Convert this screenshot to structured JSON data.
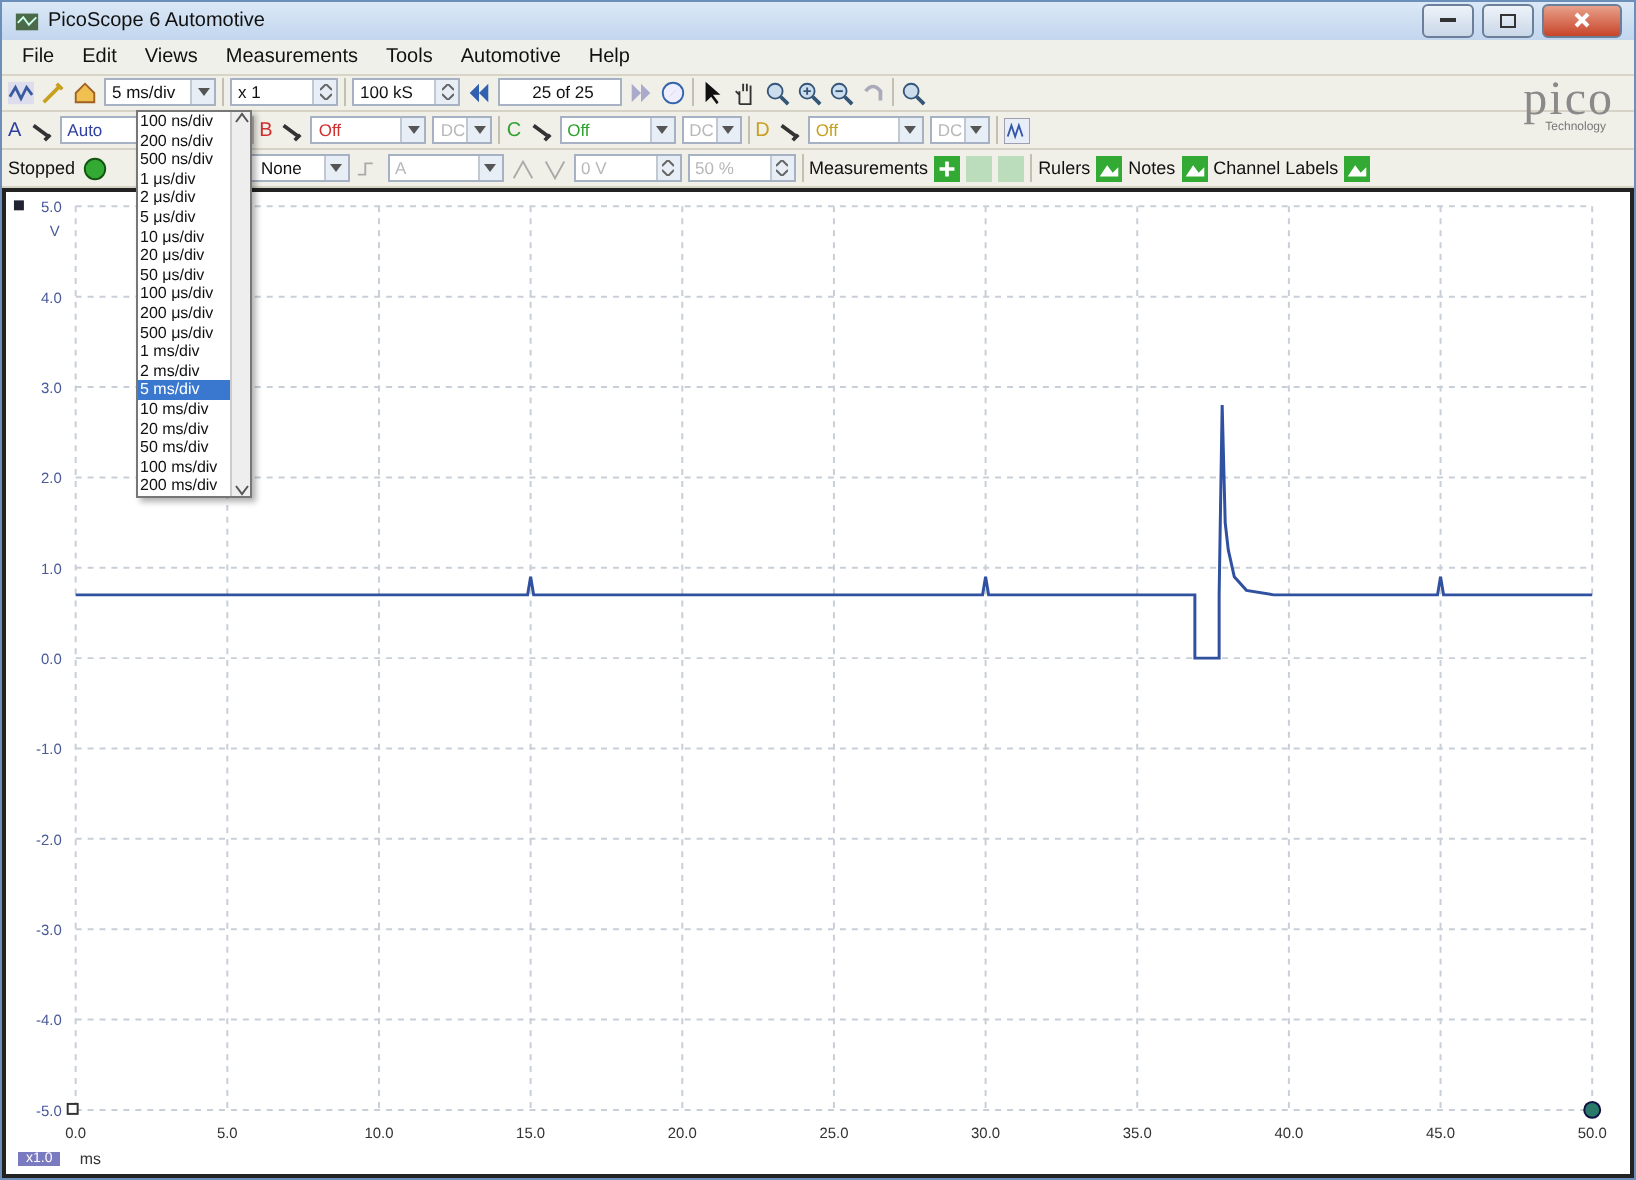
{
  "window": {
    "title": "PicoScope 6 Automotive"
  },
  "menu": [
    "File",
    "Edit",
    "Views",
    "Measurements",
    "Tools",
    "Automotive",
    "Help"
  ],
  "toolbar": {
    "timebase": "5 ms/div",
    "multiplier": "x 1",
    "samples": "100 kS",
    "buffer": "25 of 25",
    "logo": "pico",
    "logo_sub": "Technology"
  },
  "timebase_list": [
    {
      "label": "100 ns/div",
      "selected": false
    },
    {
      "label": "200 ns/div",
      "selected": false
    },
    {
      "label": "500 ns/div",
      "selected": false
    },
    {
      "label": "1 μs/div",
      "selected": false
    },
    {
      "label": "2 μs/div",
      "selected": false
    },
    {
      "label": "5 μs/div",
      "selected": false
    },
    {
      "label": "10 μs/div",
      "selected": false
    },
    {
      "label": "20 μs/div",
      "selected": false
    },
    {
      "label": "50 μs/div",
      "selected": false
    },
    {
      "label": "100 μs/div",
      "selected": false
    },
    {
      "label": "200 μs/div",
      "selected": false
    },
    {
      "label": "500 μs/div",
      "selected": false
    },
    {
      "label": "1 ms/div",
      "selected": false
    },
    {
      "label": "2 ms/div",
      "selected": false
    },
    {
      "label": "5 ms/div",
      "selected": true
    },
    {
      "label": "10 ms/div",
      "selected": false
    },
    {
      "label": "20 ms/div",
      "selected": false
    },
    {
      "label": "50 ms/div",
      "selected": false
    },
    {
      "label": "100 ms/div",
      "selected": false
    },
    {
      "label": "200 ms/div",
      "selected": false
    }
  ],
  "channels": [
    {
      "name": "A",
      "range": "Auto",
      "color": "#3040a0"
    },
    {
      "name": "B",
      "range": "Off",
      "coupling": "DC",
      "color": "#d03030"
    },
    {
      "name": "C",
      "range": "Off",
      "coupling": "DC",
      "color": "#30a030"
    },
    {
      "name": "D",
      "range": "Off",
      "coupling": "DC",
      "color": "#c8a020"
    }
  ],
  "trigger": {
    "status": "Stopped",
    "mode": "None",
    "source": "A",
    "threshold": "0 V",
    "pretrigger": "50 %"
  },
  "toggles": [
    {
      "label": "Measurements",
      "kind": "measure"
    },
    {
      "label": "Rulers",
      "kind": "toggle"
    },
    {
      "label": "Notes",
      "kind": "toggle"
    },
    {
      "label": "Channel Labels",
      "kind": "toggle"
    }
  ],
  "scope": {
    "unit_y": "V",
    "unit_x": "ms",
    "zoom": "x1.0",
    "chart_data": {
      "type": "line",
      "grid": true,
      "xlim": [
        0,
        50
      ],
      "ylim": [
        -5,
        5
      ],
      "xticks": [
        {
          "value": 0,
          "label": "0.0"
        },
        {
          "value": 5,
          "label": "5.0"
        },
        {
          "value": 10,
          "label": "10.0"
        },
        {
          "value": 15,
          "label": "15.0"
        },
        {
          "value": 20,
          "label": "20.0"
        },
        {
          "value": 25,
          "label": "25.0"
        },
        {
          "value": 30,
          "label": "30.0"
        },
        {
          "value": 35,
          "label": "35.0"
        },
        {
          "value": 40,
          "label": "40.0"
        },
        {
          "value": 45,
          "label": "45.0"
        },
        {
          "value": 50,
          "label": "50.0"
        }
      ],
      "yticks": [
        {
          "value": 5,
          "label": "5.0"
        },
        {
          "value": 4,
          "label": "4.0"
        },
        {
          "value": 3,
          "label": "3.0"
        },
        {
          "value": 2,
          "label": "2.0"
        },
        {
          "value": 1,
          "label": "1.0"
        },
        {
          "value": 0,
          "label": "0.0"
        },
        {
          "value": -1,
          "label": "-1.0"
        },
        {
          "value": -2,
          "label": "-2.0"
        },
        {
          "value": -3,
          "label": "-3.0"
        },
        {
          "value": -4,
          "label": "-4.0"
        },
        {
          "value": -5,
          "label": "-5.0"
        }
      ],
      "x": [
        0,
        14.9,
        15,
        15.1,
        29.9,
        30,
        30.1,
        36.9,
        36.9,
        37.7,
        37.7,
        37.8,
        37.9,
        38.0,
        38.2,
        38.6,
        39.5,
        44.9,
        45,
        45.1,
        50
      ],
      "series": [
        {
          "color": "#3050a0",
          "values": [
            0.7,
            0.7,
            0.9,
            0.7,
            0.7,
            0.9,
            0.7,
            0.7,
            0.0,
            0.0,
            0.7,
            2.8,
            1.5,
            1.2,
            0.9,
            0.75,
            0.7,
            0.7,
            0.9,
            0.7,
            0.7
          ]
        }
      ]
    }
  }
}
